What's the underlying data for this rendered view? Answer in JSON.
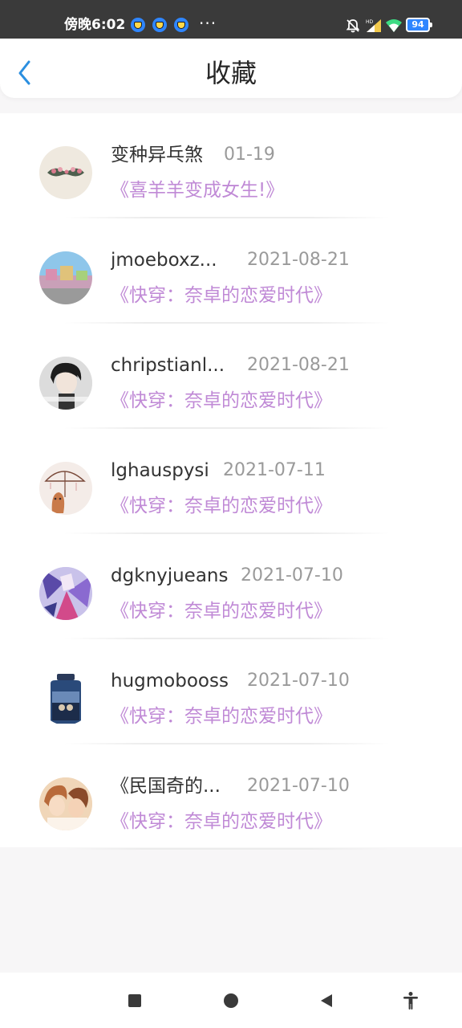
{
  "status_bar": {
    "time": "傍晚6:02",
    "more": "···",
    "battery": "94"
  },
  "header": {
    "title": "收藏",
    "back_icon": "chevron-left-icon",
    "accent_color": "#2b8fe0"
  },
  "favorites": [
    {
      "user": "变种异乓煞",
      "date": "01-19",
      "book": "《喜羊羊变成女生!》",
      "avatar": "mustache-avatar"
    },
    {
      "user": "jmoeboxz...",
      "date": "2021-08-21",
      "book": "《快穿：奈卓的恋爱时代》",
      "avatar": "street-photo-avatar"
    },
    {
      "user": "chripstianl...",
      "date": "2021-08-21",
      "book": "《快穿：奈卓的恋爱时代》",
      "avatar": "boy-portrait-avatar"
    },
    {
      "user": "lghauspysi",
      "date": "2021-07-11",
      "book": "《快穿：奈卓的恋爱时代》",
      "avatar": "umbrella-avatar"
    },
    {
      "user": "dgknyjueans",
      "date": "2021-07-10",
      "book": "《快穿：奈卓的恋爱时代》",
      "avatar": "anime-avatar"
    },
    {
      "user": "hugmobooss",
      "date": "2021-07-10",
      "book": "《快穿：奈卓的恋爱时代》",
      "avatar": "jar-avatar"
    },
    {
      "user": "《民国奇的...",
      "date": "2021-07-10",
      "book": "《快穿：奈卓的恋爱时代》",
      "avatar": "couple-avatar"
    }
  ],
  "colors": {
    "book_title": "#c08ad6",
    "date": "#9a9a9a",
    "username": "#333333"
  },
  "nav": {
    "recents": "square-icon",
    "home": "circle-icon",
    "back": "triangle-back-icon",
    "accessibility": "accessibility-icon"
  }
}
